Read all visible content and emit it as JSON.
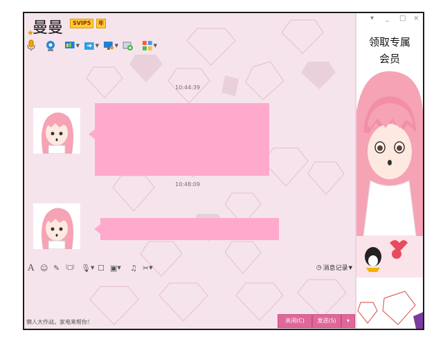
{
  "window": {
    "title": "曼曼",
    "vip_badge": "SVIP5",
    "vip_badge2": "年",
    "controls": {
      "menu": "▾",
      "minimize": "_",
      "maximize": "□",
      "close": "×"
    }
  },
  "toolbar": {
    "icons": [
      "microphone-icon",
      "video-call-icon",
      "screen-share-icon",
      "file-transfer-icon",
      "remote-desktop-icon",
      "launch-app-icon",
      "apps-grid-icon"
    ]
  },
  "chat": {
    "messages": [
      {
        "timestamp": "10:44:39"
      },
      {
        "timestamp": "10:48:09"
      }
    ]
  },
  "input_toolbar": {
    "history_label": "消息记录"
  },
  "footer": {
    "ad_text": "懒人大作战，家电来帮你！",
    "close_label": "关闭(C)",
    "send_label": "发送(S)",
    "send_arrow": "▾"
  },
  "sidebar": {
    "promo_line1": "领取专属",
    "promo_line2": "会员"
  },
  "colors": {
    "accent": "#e0679a",
    "bubble": "#ffaacc",
    "background": "#f6e4ec"
  }
}
